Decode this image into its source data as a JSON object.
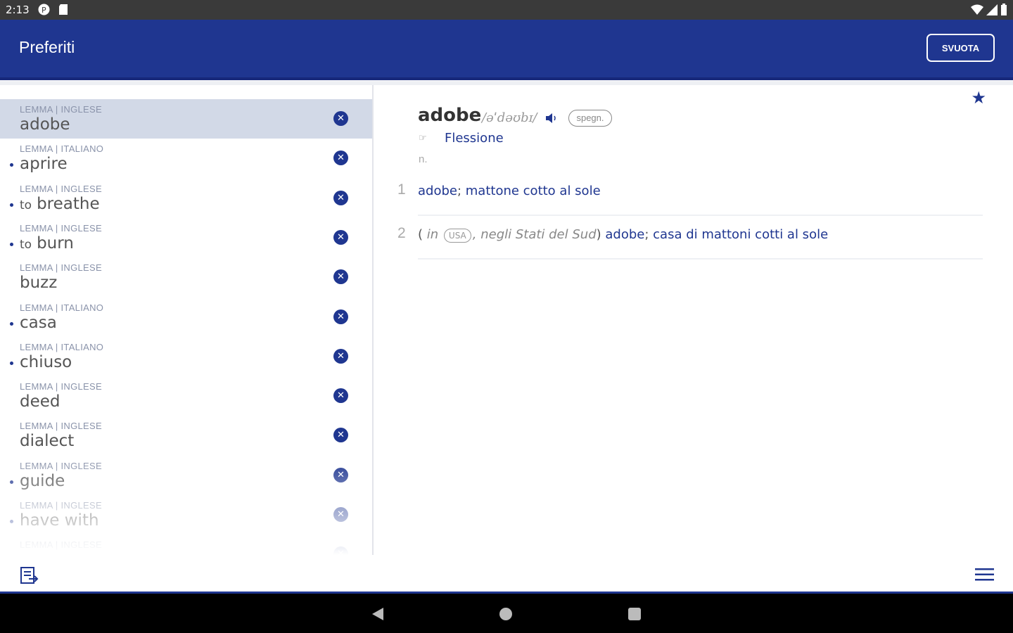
{
  "status_bar": {
    "time": "2:13"
  },
  "app_bar": {
    "title": "Preferiti",
    "clear_label": "SVUOTA"
  },
  "favorites": [
    {
      "meta": "LEMMA | INGLESE",
      "prefix": "",
      "word": "adobe",
      "dot": false,
      "selected": true
    },
    {
      "meta": "LEMMA | ITALIANO",
      "prefix": "",
      "word": "aprire",
      "dot": true,
      "selected": false
    },
    {
      "meta": "LEMMA | INGLESE",
      "prefix": "to",
      "word": "breathe",
      "dot": true,
      "selected": false
    },
    {
      "meta": "LEMMA | INGLESE",
      "prefix": "to",
      "word": "burn",
      "dot": true,
      "selected": false
    },
    {
      "meta": "LEMMA | INGLESE",
      "prefix": "",
      "word": "buzz",
      "dot": false,
      "selected": false
    },
    {
      "meta": "LEMMA | ITALIANO",
      "prefix": "",
      "word": "casa",
      "dot": true,
      "selected": false
    },
    {
      "meta": "LEMMA | ITALIANO",
      "prefix": "",
      "word": "chiuso",
      "dot": true,
      "selected": false
    },
    {
      "meta": "LEMMA | INGLESE",
      "prefix": "",
      "word": "deed",
      "dot": false,
      "selected": false
    },
    {
      "meta": "LEMMA | INGLESE",
      "prefix": "",
      "word": "dialect",
      "dot": false,
      "selected": false
    },
    {
      "meta": "LEMMA | INGLESE",
      "prefix": "",
      "word": "guide",
      "dot": true,
      "selected": false
    },
    {
      "meta": "LEMMA | INGLESE",
      "prefix": "",
      "word": "have with",
      "dot": true,
      "selected": false
    },
    {
      "meta": "LEMMA | INGLESE",
      "prefix": "",
      "word": "",
      "dot": false,
      "selected": false
    }
  ],
  "remove_glyph": "✕",
  "entry": {
    "headword": "adobe",
    "phonetic": "/əˈdəʊbɪ/",
    "spell_label": "spegn.",
    "inflection_label": "Flessione",
    "pos": "n.",
    "senses": [
      {
        "num": "1",
        "translation": "adobe",
        "separator": "; ",
        "translation2": "mattone cotto al sole"
      },
      {
        "num": "2",
        "open": "(",
        "gloss_in": "in",
        "tag": "USA",
        "gloss_rest": ", negli Stati del Sud",
        "close": ")",
        "translation": "adobe",
        "separator": "; ",
        "translation2": "casa di mattoni cotti al sole"
      }
    ]
  },
  "icons": {
    "star": "star-icon",
    "speaker": "speaker-icon",
    "export": "export-list-icon",
    "menu": "hamburger-menu-icon"
  },
  "colors": {
    "primary": "#1f3690",
    "selected_row": "#d2d9e7"
  }
}
